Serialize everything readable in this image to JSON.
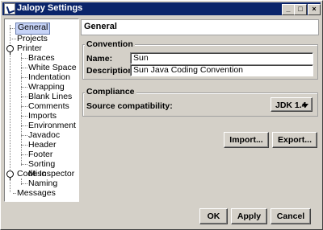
{
  "window": {
    "title": "Jalopy Settings"
  },
  "titlebar": {
    "minimize": "_",
    "maximize": "□",
    "close": "×"
  },
  "tree": {
    "items": [
      {
        "label": "General",
        "selected": true
      },
      {
        "label": "Projects"
      },
      {
        "label": "Printer"
      },
      {
        "label": "Braces"
      },
      {
        "label": "White Space"
      },
      {
        "label": "Indentation"
      },
      {
        "label": "Wrapping"
      },
      {
        "label": "Blank Lines"
      },
      {
        "label": "Comments"
      },
      {
        "label": "Imports"
      },
      {
        "label": "Environment"
      },
      {
        "label": "Javadoc"
      },
      {
        "label": "Header"
      },
      {
        "label": "Footer"
      },
      {
        "label": "Sorting"
      },
      {
        "label": "Misc"
      },
      {
        "label": "Code Inspector"
      },
      {
        "label": "Naming"
      },
      {
        "label": "Messages"
      }
    ]
  },
  "panel": {
    "title": "General",
    "convention": {
      "group_label": "Convention",
      "name_label": "Name:",
      "name_value": "Sun",
      "description_label": "Description:",
      "description_value": "Sun Java Coding Convention"
    },
    "compliance": {
      "group_label": "Compliance",
      "source_label": "Source compatibility:",
      "source_value": "JDK 1.4"
    },
    "import_button": "Import...",
    "export_button": "Export..."
  },
  "footer": {
    "ok": "OK",
    "apply": "Apply",
    "cancel": "Cancel"
  }
}
